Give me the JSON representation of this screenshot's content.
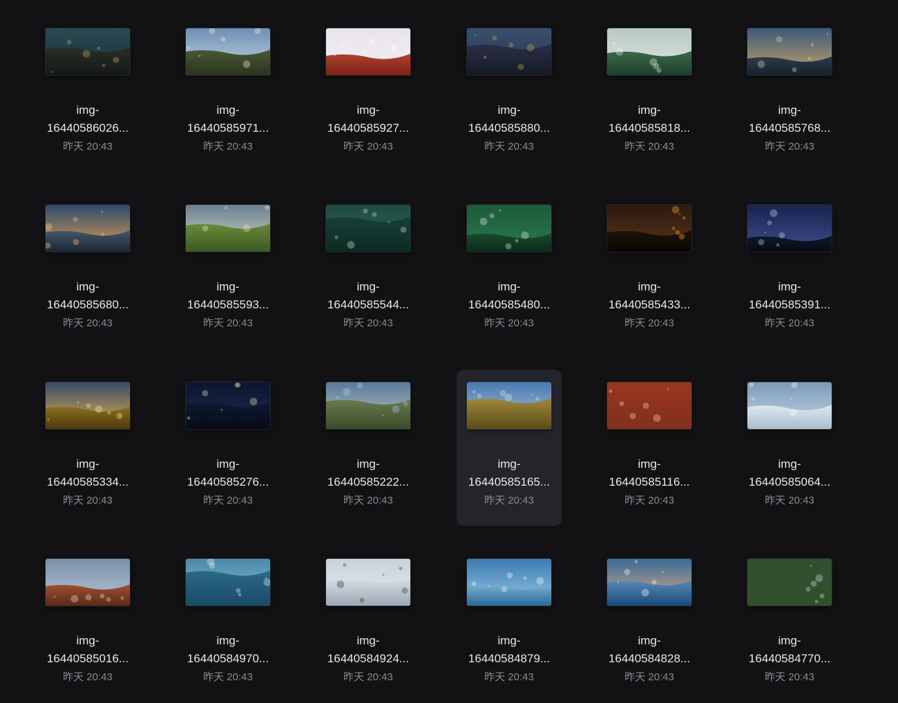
{
  "files": [
    {
      "line1": "img-",
      "line2": "16440586026...",
      "date": "昨天 20:43",
      "icon": "image-thumbnail"
    },
    {
      "line1": "img-",
      "line2": "16440585971...",
      "date": "昨天 20:43",
      "icon": "image-thumbnail"
    },
    {
      "line1": "img-",
      "line2": "16440585927...",
      "date": "昨天 20:43",
      "icon": "image-thumbnail"
    },
    {
      "line1": "img-",
      "line2": "16440585880...",
      "date": "昨天 20:43",
      "icon": "image-thumbnail"
    },
    {
      "line1": "img-",
      "line2": "16440585818...",
      "date": "昨天 20:43",
      "icon": "image-thumbnail"
    },
    {
      "line1": "img-",
      "line2": "16440585768...",
      "date": "昨天 20:43",
      "icon": "image-thumbnail"
    },
    {
      "line1": "img-",
      "line2": "16440585680...",
      "date": "昨天 20:43",
      "icon": "image-thumbnail"
    },
    {
      "line1": "img-",
      "line2": "16440585593...",
      "date": "昨天 20:43",
      "icon": "image-thumbnail"
    },
    {
      "line1": "img-",
      "line2": "16440585544...",
      "date": "昨天 20:43",
      "icon": "image-thumbnail"
    },
    {
      "line1": "img-",
      "line2": "16440585480...",
      "date": "昨天 20:43",
      "icon": "image-thumbnail"
    },
    {
      "line1": "img-",
      "line2": "16440585433...",
      "date": "昨天 20:43",
      "icon": "image-thumbnail"
    },
    {
      "line1": "img-",
      "line2": "16440585391...",
      "date": "昨天 20:43",
      "icon": "image-thumbnail"
    },
    {
      "line1": "img-",
      "line2": "16440585334...",
      "date": "昨天 20:43",
      "icon": "image-thumbnail"
    },
    {
      "line1": "img-",
      "line2": "16440585276...",
      "date": "昨天 20:43",
      "icon": "image-thumbnail"
    },
    {
      "line1": "img-",
      "line2": "16440585222...",
      "date": "昨天 20:43",
      "icon": "image-thumbnail"
    },
    {
      "line1": "img-",
      "line2": "16440585165...",
      "date": "昨天 20:43",
      "icon": "image-thumbnail",
      "selected": true
    },
    {
      "line1": "img-",
      "line2": "16440585116...",
      "date": "昨天 20:43",
      "icon": "image-thumbnail"
    },
    {
      "line1": "img-",
      "line2": "16440585064...",
      "date": "昨天 20:43",
      "icon": "image-thumbnail"
    },
    {
      "line1": "img-",
      "line2": "16440585016...",
      "date": "昨天 20:43",
      "icon": "image-thumbnail"
    },
    {
      "line1": "img-",
      "line2": "16440584970...",
      "date": "昨天 20:43",
      "icon": "image-thumbnail"
    },
    {
      "line1": "img-",
      "line2": "16440584924...",
      "date": "昨天 20:43",
      "icon": "image-thumbnail"
    },
    {
      "line1": "img-",
      "line2": "16440584879...",
      "date": "昨天 20:43",
      "icon": "image-thumbnail"
    },
    {
      "line1": "img-",
      "line2": "16440584828...",
      "date": "昨天 20:43",
      "icon": "image-thumbnail"
    },
    {
      "line1": "img-",
      "line2": "16440584770...",
      "date": "昨天 20:43",
      "icon": "image-thumbnail"
    }
  ],
  "colors": {
    "background": "#121214",
    "selection": "#24252b",
    "filename": "#e9e9ec",
    "date": "#8a8b91"
  }
}
